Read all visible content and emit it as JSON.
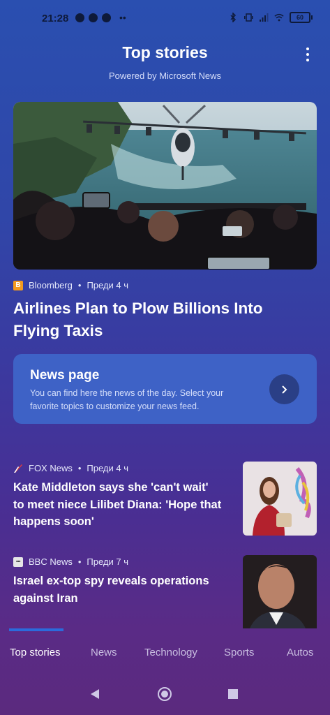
{
  "status_bar": {
    "time": "21:28",
    "battery": "60"
  },
  "header": {
    "title": "Top stories",
    "subtitle": "Powered by Microsoft News"
  },
  "hero_article": {
    "source": "Bloomberg",
    "source_logo_letter": "B",
    "time": "Преди 4 ч",
    "headline_line1": "Airlines Plan to Plow Billions Into",
    "headline_line2": "Flying Taxis"
  },
  "news_card": {
    "title": "News page",
    "text_line1": "You can find here the news of the day. Select your",
    "text_line2": "favorite topics to customize your news feed."
  },
  "articles": [
    {
      "source": "FOX News",
      "time": "Преди 4 ч",
      "line1": "Kate Middleton says she 'can't wait'",
      "line2": "to meet niece Lilibet Diana: 'Hope that",
      "line3": "happens soon'"
    },
    {
      "source": "BBC News",
      "time": "Преди 7 ч",
      "line1": "Israel ex-top spy reveals operations",
      "line2": "against Iran"
    }
  ],
  "tabs": [
    "Top stories",
    "News",
    "Technology",
    "Sports",
    "Autos"
  ],
  "colors": {
    "accent": "#2b6bdc",
    "card": "#3e62c6",
    "bloomberg": "#f39a1e"
  }
}
